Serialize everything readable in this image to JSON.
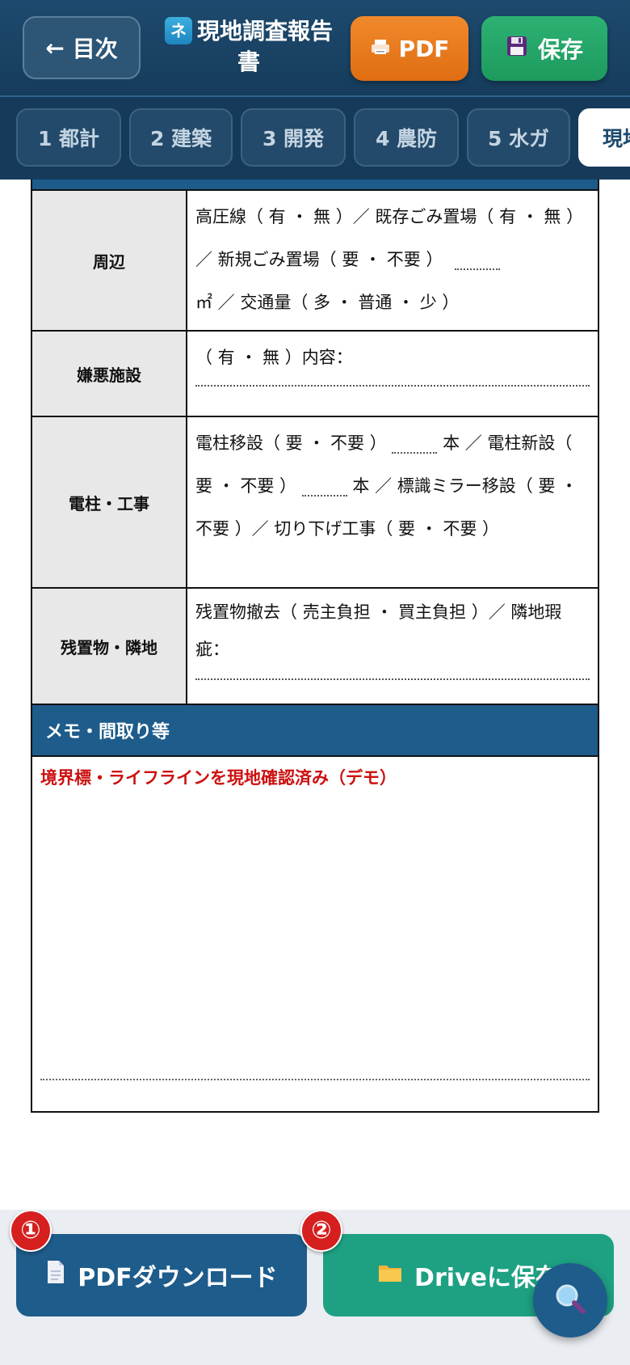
{
  "header": {
    "back_label": "目次",
    "back_arrow": "←",
    "app_badge": "ネ",
    "title": "現地調査報告書",
    "pdf_label": "PDF",
    "save_label": "保存"
  },
  "tabs": [
    {
      "label": "1 都計"
    },
    {
      "label": "2 建築"
    },
    {
      "label": "3 開発"
    },
    {
      "label": "4 農防"
    },
    {
      "label": "5 水ガ"
    },
    {
      "label": "現地"
    }
  ],
  "rows": {
    "surroundings": {
      "label": "周辺",
      "text1": "高圧線（ 有 ・ 無 ）／ 既存ごみ置場（ 有 ・ 無 ）／ 新規ごみ置場（ 要 ・ 不要 ）",
      "text2": "㎡ ／ 交通量（ 多 ・ 普通 ・ 少 ）"
    },
    "nuisance": {
      "label": "嫌悪施設",
      "text": "（ 有 ・ 無 ）内容："
    },
    "poles": {
      "label": "電柱・工事",
      "text1": "電柱移設（ 要 ・ 不要 ）",
      "text2": "本 ／ 電柱新設（ 要 ・ 不要 ）",
      "text3": "本 ／ 標識ミラー移設（ 要 ・ 不要 ）／ 切り下げ工事（ 要 ・ 不要 ）"
    },
    "remaining": {
      "label": "残置物・隣地",
      "text": "残置物撤去（ 売主負担 ・ 買主負担 ）／ 隣地瑕疵："
    }
  },
  "memo": {
    "heading": "メモ・間取り等",
    "text": "境界標・ライフラインを現地確認済み（デモ）"
  },
  "bottom": {
    "pdf_download_label": "PDFダウンロード",
    "drive_save_label": "Driveに保存",
    "badge1": "①",
    "badge2": "②"
  },
  "colors": {
    "header_bg": "#1d4a6e",
    "pdf_orange": "#e97d1f",
    "save_green": "#22a468",
    "section_blue": "#1e5c8b",
    "drive_teal": "#1ea083",
    "memo_red": "#cc1010"
  },
  "icons": [
    "arrow-left-icon",
    "app-badge-icon",
    "printer-icon",
    "floppy-disk-icon",
    "document-icon",
    "folder-icon",
    "search-icon"
  ]
}
